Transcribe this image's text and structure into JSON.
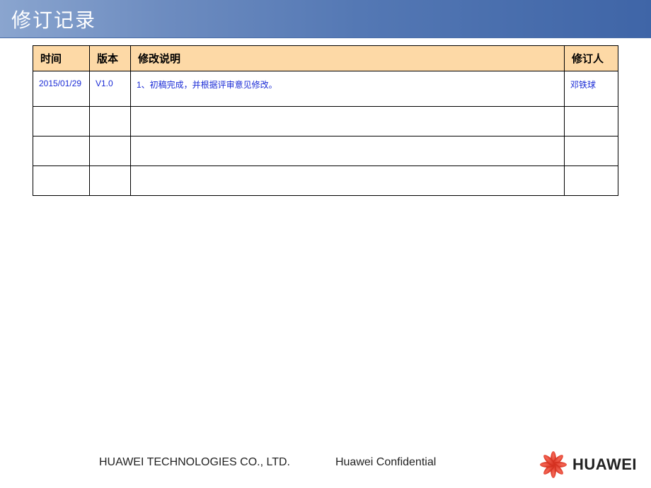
{
  "title": "修订记录",
  "table": {
    "headers": [
      "时间",
      "版本",
      "修改说明",
      "修订人"
    ],
    "rows": [
      {
        "time": "2015/01/29",
        "version": "V1.0",
        "description": "1、初稿完成，并根据评审意见修改。",
        "reviser": "邓铁球"
      },
      {
        "time": "",
        "version": "",
        "description": "",
        "reviser": ""
      },
      {
        "time": "",
        "version": "",
        "description": "",
        "reviser": ""
      },
      {
        "time": "",
        "version": "",
        "description": "",
        "reviser": ""
      }
    ]
  },
  "footer": {
    "company": "HUAWEI TECHNOLOGIES CO., LTD.",
    "confidential": "Huawei Confidential",
    "brand": "HUAWEI"
  }
}
